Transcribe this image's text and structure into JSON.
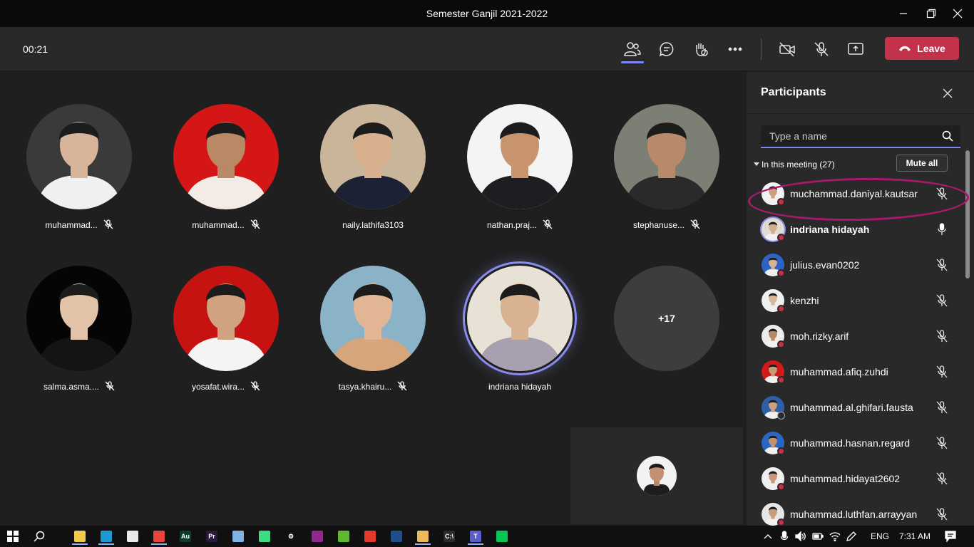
{
  "window": {
    "title": "Semester Ganjil 2021-2022"
  },
  "toolbar": {
    "timer": "00:21",
    "leave_label": "Leave"
  },
  "tiles": [
    {
      "name": "muhammad...",
      "muted": true,
      "bg": "#3a3a3a",
      "skin": "#d8b49a",
      "shirt": "#f0f0f0"
    },
    {
      "name": "muhammad...",
      "muted": true,
      "bg": "#d41616",
      "skin": "#b98864",
      "shirt": "#f3ece6"
    },
    {
      "name": "naily.lathifa3103",
      "muted": false,
      "bg": "#c9b59a",
      "skin": "#d9b08e",
      "shirt": "#1c2233"
    },
    {
      "name": "nathan.praj...",
      "muted": true,
      "bg": "#f4f4f4",
      "skin": "#c7946d",
      "shirt": "#1e1e22"
    },
    {
      "name": "stephanuse...",
      "muted": true,
      "bg": "#7c7f74",
      "skin": "#b88a6a",
      "shirt": "#2a2a2a"
    },
    {
      "name": "salma.asma....",
      "muted": true,
      "bg": "#050505",
      "skin": "#e2c3a8",
      "shirt": "#141414"
    },
    {
      "name": "yosafat.wira...",
      "muted": true,
      "bg": "#c71212",
      "skin": "#d0a27f",
      "shirt": "#f4f4f4"
    },
    {
      "name": "tasya.khairu...",
      "muted": true,
      "bg": "#8bb3c7",
      "skin": "#e2b694",
      "shirt": "#d7a57c"
    },
    {
      "name": "indriana hidayah",
      "muted": false,
      "speaking": true,
      "bg": "#e8e2d6",
      "skin": "#d9b292",
      "shirt": "#a7a0b0"
    }
  ],
  "overflow_tile": {
    "label": "+17"
  },
  "panel": {
    "title": "Participants",
    "search_placeholder": "Type a name",
    "meeting_header": "In this meeting (27)",
    "mute_all_label": "Mute all",
    "participants": [
      {
        "name": "muchammad.daniyal.kautsar",
        "mic": "muted",
        "bold": false,
        "bg": "#f2f2f2",
        "skin": "#caa07e",
        "dot": "red"
      },
      {
        "name": "indriana hidayah",
        "mic": "on",
        "bold": true,
        "bg": "#e0dcd4",
        "skin": "#d4ad8d",
        "dot": "red",
        "ring": true
      },
      {
        "name": "julius.evan0202",
        "mic": "muted",
        "bold": false,
        "bg": "#2d63c8",
        "skin": "#d7b294",
        "dot": "red"
      },
      {
        "name": "kenzhi",
        "mic": "muted",
        "bold": false,
        "bg": "#f0f0f0",
        "skin": "#d8b69b",
        "dot": "red"
      },
      {
        "name": "moh.rizky.arif",
        "mic": "muted",
        "bold": false,
        "bg": "#ececec",
        "skin": "#b88866",
        "dot": "red"
      },
      {
        "name": "muhammad.afiq.zuhdi",
        "mic": "muted",
        "bold": false,
        "bg": "#d21a1a",
        "skin": "#c89a78",
        "dot": "red"
      },
      {
        "name": "muhammad.al.ghifari.fausta",
        "mic": "muted",
        "bold": false,
        "bg": "#2f5fa8",
        "skin": "#cfa07e",
        "dot": "grey"
      },
      {
        "name": "muhammad.hasnan.regard",
        "mic": "muted",
        "bold": false,
        "bg": "#2a66c4",
        "skin": "#c29271",
        "dot": "red"
      },
      {
        "name": "muhammad.hidayat2602",
        "mic": "muted",
        "bold": false,
        "bg": "#efefef",
        "skin": "#c8987a",
        "dot": "red"
      },
      {
        "name": "muhammad.luthfan.arrayyan",
        "mic": "muted",
        "bold": false,
        "bg": "#e6e6e6",
        "skin": "#c99c7a",
        "dot": "red"
      }
    ]
  },
  "taskbar": {
    "apps": [
      {
        "name": "file-explorer-icon",
        "color": "#f2c84b",
        "label": ""
      },
      {
        "name": "edge-icon",
        "color": "#1d9ad6",
        "label": ""
      },
      {
        "name": "store-icon",
        "color": "#eaeaea",
        "label": ""
      },
      {
        "name": "chrome-icon",
        "color": "#e8453c",
        "label": ""
      },
      {
        "name": "audition-icon",
        "color": "#0f3b2e",
        "label": "Au"
      },
      {
        "name": "premiere-icon",
        "color": "#2a1a3d",
        "label": "Pr"
      },
      {
        "name": "notepad-icon",
        "color": "#7fb2e6",
        "label": ""
      },
      {
        "name": "android-studio-icon",
        "color": "#3ddc84",
        "label": ""
      },
      {
        "name": "settings-icon",
        "color": "#101010",
        "label": "⚙"
      },
      {
        "name": "winrar-icon",
        "color": "#8e2a8e",
        "label": ""
      },
      {
        "name": "utorrent-icon",
        "color": "#5fb832",
        "label": ""
      },
      {
        "name": "acrobat-icon",
        "color": "#e23b2e",
        "label": ""
      },
      {
        "name": "powershell-icon",
        "color": "#1f4e8c",
        "label": ""
      },
      {
        "name": "paint-icon",
        "color": "#eeb85d",
        "label": ""
      },
      {
        "name": "cmd-icon",
        "color": "#2b2b2b",
        "label": "C:\\"
      },
      {
        "name": "teams-icon",
        "color": "#5b5fc7",
        "label": "T"
      },
      {
        "name": "line-icon",
        "color": "#06c755",
        "label": ""
      }
    ],
    "language": "ENG",
    "time": "7:31 AM"
  }
}
